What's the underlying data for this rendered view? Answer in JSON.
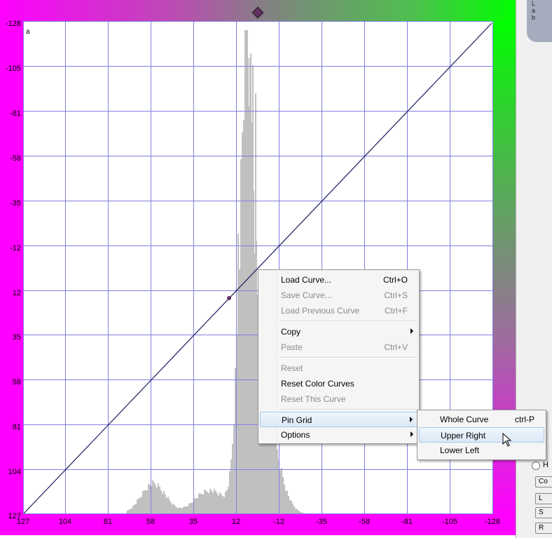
{
  "channel_label": "a",
  "side_panel": {
    "tab_text": "L\na\nb",
    "radio_label": "H",
    "buttons": [
      "Co",
      "L",
      "S",
      "R"
    ]
  },
  "y_axis_ticks": [
    "-128",
    "-105",
    "-81",
    "-58",
    "-35",
    "-12",
    "12",
    "35",
    "58",
    "81",
    "104",
    "127"
  ],
  "x_axis_ticks": [
    "127",
    "104",
    "81",
    "58",
    "35",
    "12",
    "-12",
    "-35",
    "-58",
    "-81",
    "-105",
    "-128"
  ],
  "colors": {
    "frame_magenta": "#ff00ff",
    "frame_green": "#00ff00",
    "grid": "#8080e0",
    "histogram": "#c0c0c0",
    "curve": "#1a1a5a"
  },
  "context_menu": {
    "items": [
      {
        "label": "Load Curve...",
        "shortcut": "Ctrl+O",
        "enabled": true
      },
      {
        "label": "Save Curve...",
        "shortcut": "Ctrl+S",
        "enabled": false
      },
      {
        "label": "Load Previous Curve",
        "shortcut": "Ctrl+F",
        "enabled": false
      },
      {
        "label": "Copy",
        "shortcut": "",
        "enabled": true,
        "submenu": true
      },
      {
        "label": "Paste",
        "shortcut": "Ctrl+V",
        "enabled": false
      },
      {
        "label": "Reset",
        "shortcut": "",
        "enabled": false
      },
      {
        "label": "Reset Color Curves",
        "shortcut": "",
        "enabled": true
      },
      {
        "label": "Reset This Curve",
        "shortcut": "",
        "enabled": false
      },
      {
        "label": "Pin Grid",
        "shortcut": "",
        "enabled": true,
        "submenu": true,
        "highlighted": true
      },
      {
        "label": "Options",
        "shortcut": "",
        "enabled": true,
        "submenu": true
      }
    ]
  },
  "pin_grid_submenu": {
    "items": [
      {
        "label": "Whole Curve",
        "shortcut": "ctrl-P"
      },
      {
        "label": "Upper Right",
        "shortcut": "",
        "highlighted": true
      },
      {
        "label": "Lower Left",
        "shortcut": ""
      }
    ]
  }
}
